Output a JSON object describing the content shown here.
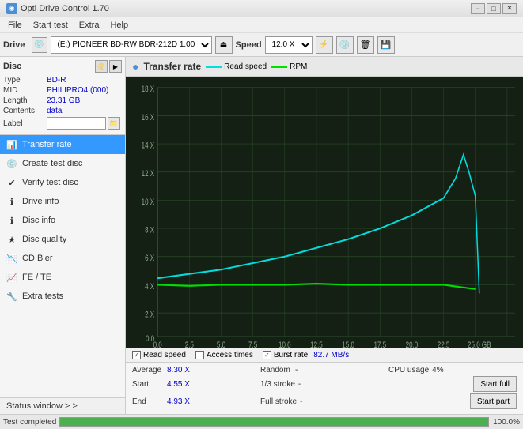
{
  "titlebar": {
    "title": "Opti Drive Control 1.70",
    "min_label": "−",
    "max_label": "□",
    "close_label": "✕"
  },
  "menu": {
    "items": [
      "File",
      "Start test",
      "Extra",
      "Help"
    ]
  },
  "drivebar": {
    "drive_label": "Drive",
    "drive_value": "(E:)  PIONEER BD-RW   BDR-212D 1.00",
    "speed_label": "Speed",
    "speed_value": "12.0 X ↓"
  },
  "disc": {
    "title": "Disc",
    "type_label": "Type",
    "type_value": "BD-R",
    "mid_label": "MID",
    "mid_value": "PHILIPRO4 (000)",
    "length_label": "Length",
    "length_value": "23.31 GB",
    "contents_label": "Contents",
    "contents_value": "data",
    "label_label": "Label",
    "label_placeholder": ""
  },
  "nav": {
    "items": [
      {
        "label": "Transfer rate",
        "active": true
      },
      {
        "label": "Create test disc",
        "active": false
      },
      {
        "label": "Verify test disc",
        "active": false
      },
      {
        "label": "Drive info",
        "active": false
      },
      {
        "label": "Disc info",
        "active": false
      },
      {
        "label": "Disc quality",
        "active": false
      },
      {
        "label": "CD Bler",
        "active": false
      },
      {
        "label": "FE / TE",
        "active": false
      },
      {
        "label": "Extra tests",
        "active": false
      }
    ]
  },
  "status_window": {
    "label": "Status window > >"
  },
  "statusbar": {
    "text": "Test completed",
    "progress": 100,
    "progress_label": "100.0%"
  },
  "chart": {
    "title": "Transfer rate",
    "legend": [
      {
        "label": "Read speed",
        "color": "#00e0e0"
      },
      {
        "label": "RPM",
        "color": "#00e000"
      }
    ],
    "y_axis": [
      "18 X",
      "16 X",
      "14 X",
      "12 X",
      "10 X",
      "8 X",
      "6 X",
      "4 X",
      "2 X",
      "0.0"
    ],
    "x_axis": [
      "0.0",
      "2.5",
      "5.0",
      "7.5",
      "10.0",
      "12.5",
      "15.0",
      "17.5",
      "20.0",
      "22.5",
      "25.0 GB"
    ]
  },
  "checkboxes": {
    "read_speed_label": "Read speed",
    "read_speed_checked": true,
    "access_times_label": "Access times",
    "access_times_checked": false,
    "burst_rate_label": "Burst rate",
    "burst_rate_checked": true,
    "burst_rate_value": "82.7 MB/s"
  },
  "stats": {
    "average_label": "Average",
    "average_value": "8.30 X",
    "random_label": "Random",
    "random_value": "-",
    "cpu_label": "CPU usage",
    "cpu_value": "4%",
    "start_label": "Start",
    "start_value": "4.55 X",
    "stroke_1_label": "1/3 stroke",
    "stroke_1_value": "-",
    "start_full_label": "Start full",
    "end_label": "End",
    "end_value": "4.93 X",
    "full_stroke_label": "Full stroke",
    "full_stroke_value": "-",
    "start_part_label": "Start part"
  }
}
